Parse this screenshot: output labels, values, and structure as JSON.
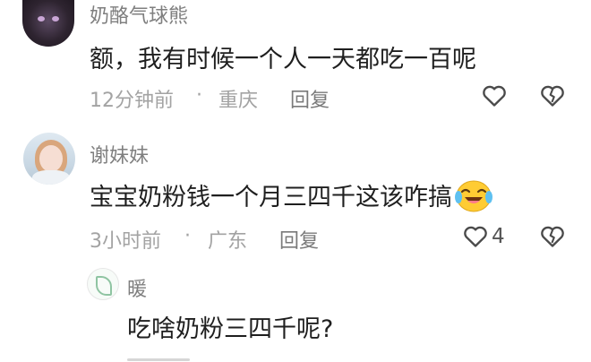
{
  "comments": [
    {
      "username": "奶酪气球熊",
      "text": "额，我有时候一个人一天都吃一百呢",
      "time": "12分钟前",
      "sep": "·",
      "location": "重庆",
      "reply_label": "回复",
      "likes": ""
    },
    {
      "username": "谢妹妹",
      "text": "宝宝奶粉钱一个月三四千这该咋搞",
      "time": "3小时前",
      "sep": "·",
      "location": "广东",
      "reply_label": "回复",
      "likes": "4"
    }
  ],
  "reply": {
    "username": "暖",
    "text": "吃啥奶粉三四千呢?"
  },
  "icons": {
    "like": "heart-outline-icon",
    "dislike": "broken-heart-icon",
    "emoji": "crying-laughing-emoji-icon"
  },
  "colors": {
    "text": "#1f1f1f",
    "username": "#7f7f7f",
    "meta": "#a3a3a3"
  }
}
